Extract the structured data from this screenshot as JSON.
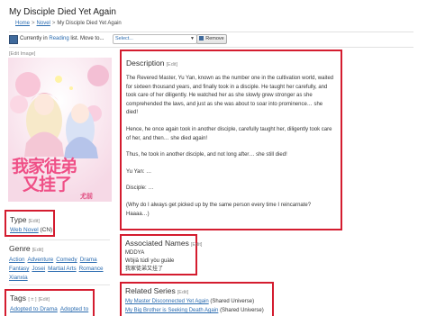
{
  "page_title": "My Disciple Died Yet Again",
  "breadcrumb": {
    "home": "Home",
    "novel": "Novel",
    "current": "My Disciple Died Yet Again",
    "sep": ">"
  },
  "reading_bar": {
    "prefix": "Currently in",
    "list": "Reading",
    "suffix": "list. Move to...",
    "select_value": "Select...",
    "remove_label": "Remove"
  },
  "edit_image": "[Edit Image]",
  "cover": {
    "title_line1": "我家徒弟",
    "title_line2": "又挂了",
    "author": "尤前"
  },
  "description": {
    "heading": "Description",
    "edit": "[Edit]",
    "paragraphs": [
      "The Revered Master, Yu Yan, known as the number one in the cultivation world, waited for sixteen thousand years, and finally took in a disciple. He taught her carefully, and took care of her diligently. He watched her as she slowly grew stronger as she comprehended the laws, and just as she was about to soar into prominence… she died!",
      "Hence, he once again took in another disciple, carefully taught her, diligently took care of her, and then… she died again!",
      "Thus, he took in another disciple, and not long after… she still died!",
      "Yu Yan: …",
      "Disciple: …",
      "(Why do I always get picked up by the same person every time I reincarnate? Haaaa…)"
    ]
  },
  "type": {
    "heading": "Type",
    "edit": "[Edit]",
    "value": "Web Novel",
    "origin": "(CN)"
  },
  "genre": {
    "heading": "Genre",
    "edit": "[Edit]",
    "items": [
      "Action",
      "Adventure",
      "Comedy",
      "Drama",
      "Fantasy",
      "Josei",
      "Martial Arts",
      "Romance",
      "Xianxia"
    ]
  },
  "tags": {
    "heading": "Tags",
    "bracket_del": "[ ± ]",
    "edit": "[Edit]",
    "items": [
      "Adopted to Drama",
      "Adopted to"
    ]
  },
  "associated_names": {
    "heading": "Associated Names",
    "edit": "[Edit]",
    "items": [
      "MDDYA",
      "Wǒjiā túdì yòu guàle",
      "我家徒弟又挂了"
    ]
  },
  "related_series": {
    "heading": "Related Series",
    "edit": "[Edit]",
    "items": [
      {
        "title": "My Master Disconnected Yet Again",
        "note": "(Shared Universe)"
      },
      {
        "title": "My Big Brother is Seeking Death Again",
        "note": "(Shared Universe)"
      }
    ]
  },
  "colors": {
    "link": "#2b6cb0",
    "highlight_box": "#d41c2f",
    "cover_pink": "#ef4f86"
  }
}
